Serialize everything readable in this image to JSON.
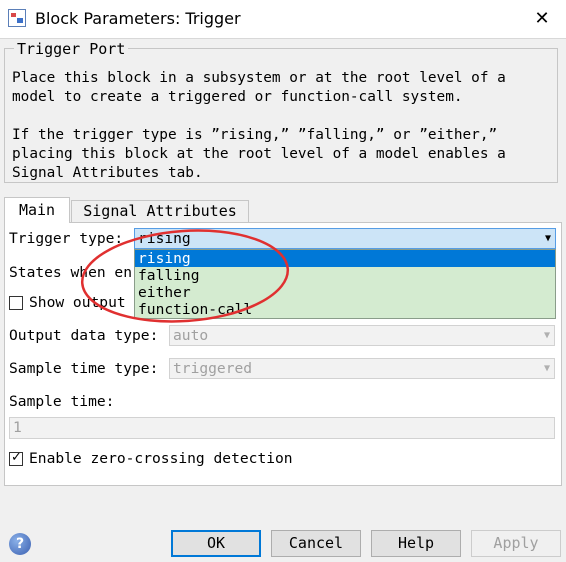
{
  "window": {
    "title": "Block Parameters: Trigger"
  },
  "group": {
    "title": "Trigger Port",
    "description": "Place this block in a subsystem or at the root level of a\nmodel to create a triggered or function-call system.\n\nIf the trigger type is ”rising,” ”falling,” or ”either,”\nplacing this block at the root level of a model enables a\nSignal Attributes tab."
  },
  "tabs": [
    {
      "label": "Main",
      "active": true
    },
    {
      "label": "Signal Attributes",
      "active": false
    }
  ],
  "fields": {
    "trigger_type": {
      "label": "Trigger type:",
      "value": "rising",
      "options": [
        "rising",
        "falling",
        "either",
        "function-call"
      ]
    },
    "states_when_enabling": {
      "label_visible": "States when en"
    },
    "show_output_port": {
      "label_visible": "Show output",
      "checked": false
    },
    "output_data_type": {
      "label": "Output data type:",
      "value": "auto"
    },
    "sample_time_type": {
      "label": "Sample time type:",
      "value": "triggered"
    },
    "sample_time": {
      "label": "Sample time:",
      "value": "1"
    },
    "zero_crossing": {
      "label": "Enable zero-crossing detection",
      "checked": true
    }
  },
  "buttons": {
    "ok": "OK",
    "cancel": "Cancel",
    "help": "Help",
    "apply": "Apply"
  },
  "icons": {
    "help": "help-icon",
    "close": "close-icon",
    "dropdown_arrow": "chevron-down-icon"
  },
  "colors": {
    "selection": "#0078d7",
    "dropdown_bg": "#d4ebd0",
    "annotation": "#e03030"
  }
}
